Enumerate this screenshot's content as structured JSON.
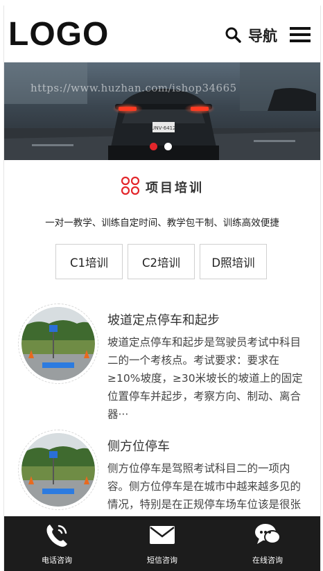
{
  "header": {
    "logo_text": "LOGO",
    "nav_label": "导航"
  },
  "banner": {
    "watermark": "https://www.huzhan.com/ishop34665",
    "slide_count": 2,
    "active_slide": 1,
    "plate_text": "UNV·6412"
  },
  "section": {
    "title": "项目培训",
    "subtitle": "一对一教学、训练自定时间、教学包干制、训练高效便捷",
    "tabs": [
      {
        "label": "C1培训"
      },
      {
        "label": "C2培训"
      },
      {
        "label": "D照培训"
      }
    ]
  },
  "items": [
    {
      "title": "坡道定点停车和起步",
      "desc": "坡道定点停车和起步是驾驶员考试中科目二的一个考核点。考试要求：要求在≥10%坡度，≥30米坡长的坡道上的固定位置停车并起步，考察方向、制动、离合器···"
    },
    {
      "title": "侧方位停车",
      "desc": "侧方位停车是驾照考试科目二的一项内容。侧方位停车是在城市中越来越多见的情况，特别是在正规停车场车位该是很张如上，但多数方都停车位的"
    }
  ],
  "footer": {
    "items": [
      {
        "label": "电话咨询",
        "icon": "phone-icon"
      },
      {
        "label": "短信咨询",
        "icon": "envelope-icon"
      },
      {
        "label": "在线咨询",
        "icon": "chat-icon"
      }
    ]
  },
  "colors": {
    "accent": "#e3262b",
    "footer_bg": "#1c1c1c"
  }
}
